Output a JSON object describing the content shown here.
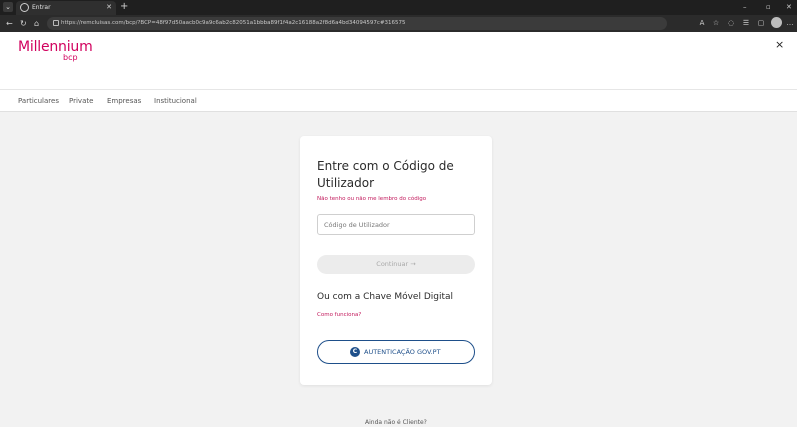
{
  "browser": {
    "tab_title": "Entrar",
    "tab_close": "✕",
    "new_tab": "+",
    "url": "https://remcluisas.com/bcp/?BCP=48f97d50aacb0c9a9c6ab2c82051a1bbba89f1f4a2c16188a2f8d6a4bd34094597c#316575",
    "window_minimize": "–",
    "window_maximize": "▫",
    "window_close": "✕"
  },
  "header": {
    "logo_main": "Millennium",
    "logo_sub": "bcp",
    "close": "×"
  },
  "nav": {
    "items": [
      "Particulares",
      "Private",
      "Empresas",
      "Institucional"
    ]
  },
  "login": {
    "title": "Entre com o Código de Utilizador",
    "forgot": "Não tenho ou não me lembro do código",
    "input_placeholder": "Código de Utilizador",
    "continue": "Continuar  →",
    "chave_title": "Ou com a Chave Móvel Digital",
    "como": "Como funciona?",
    "gov_icon": "C",
    "gov_button": "AUTENTICAÇÃO GOV.PT"
  },
  "footer": {
    "not_client": "Ainda não é Cliente?"
  }
}
